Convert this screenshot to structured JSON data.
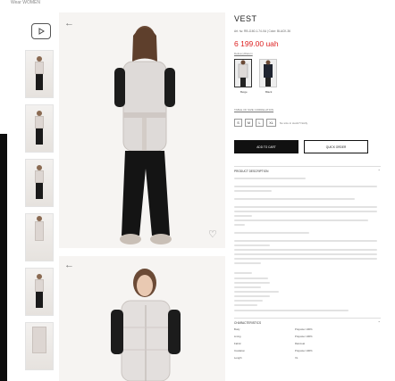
{
  "top_nav": {
    "cut_text": "Wear WOMEN"
  },
  "product": {
    "title": "VEST",
    "sku": "Art. №: RB-1160-1-74-XA  |  Color: BLACK-36",
    "price": "6 199.00 uah",
    "delivery_link": "Delivery/Return",
    "colors": [
      {
        "label": "Beige",
        "hex": "#e8e3df",
        "selected": true
      },
      {
        "label": "Black",
        "hex": "#1f2430",
        "selected": false
      }
    ],
    "size_chart_link": "TABLE OF SIZE CORRELATION",
    "sizes": [
      "S",
      "M",
      "L",
      "XL"
    ],
    "size_note": "No size in stock? Notify",
    "add_to_cart": "ADD TO CART",
    "quick_order": "QUICK ORDER",
    "description_title": "PRODUCT DESCRIPTION",
    "characteristics_title": "CHARACTERISTICS",
    "characteristics": [
      {
        "name": "Body",
        "value": "Polyester 100%"
      },
      {
        "name": "Lining",
        "value": "Polyester 100%"
      },
      {
        "name": "Fabric",
        "value": "Raincoat"
      },
      {
        "name": "Insulation",
        "value": "Polyester 100%"
      },
      {
        "name": "Length",
        "value": "XL"
      }
    ]
  },
  "gallery": {
    "thumb_count": 7
  },
  "icons": {
    "play": "play-icon",
    "back": "arrow-left-icon",
    "wish": "heart-icon",
    "chev": "chevron-down-icon"
  },
  "colors": {
    "price": "#dd2222",
    "button": "#111111",
    "strip": "#0d0d0d"
  }
}
